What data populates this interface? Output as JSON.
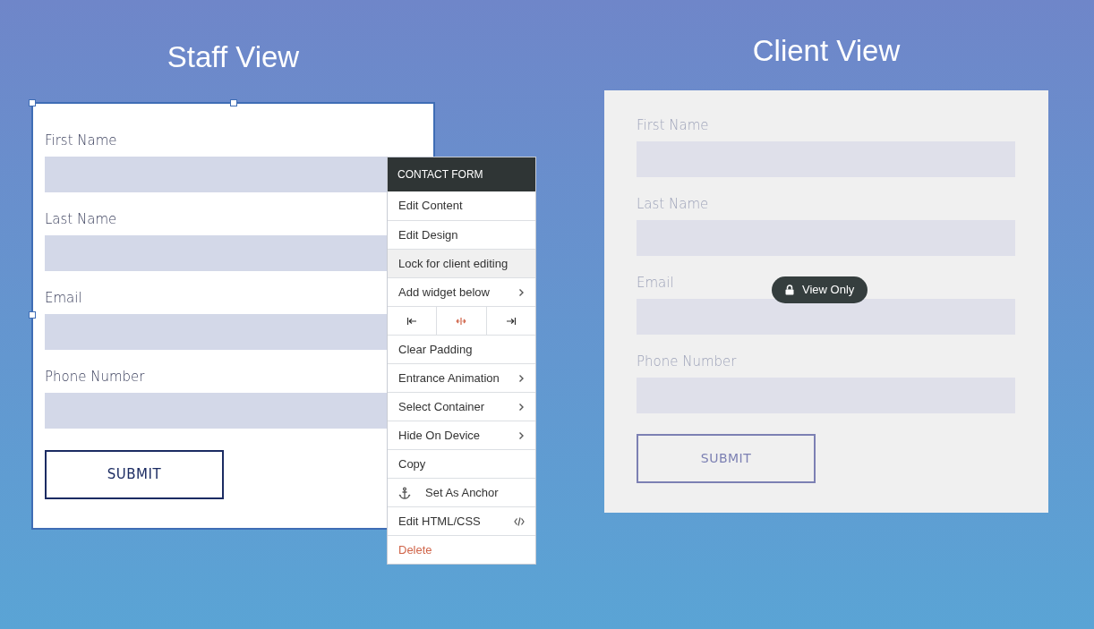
{
  "staff_view": {
    "title": "Staff View",
    "fields": [
      {
        "label": "First Name"
      },
      {
        "label": "Last Name"
      },
      {
        "label": "Email"
      },
      {
        "label": "Phone Number"
      }
    ],
    "submit": "SUBMIT"
  },
  "context_menu": {
    "header": "CONTACT FORM",
    "items": [
      {
        "kind": "item",
        "label": "Edit Content",
        "highlighted": false
      },
      {
        "kind": "item",
        "label": "Edit Design",
        "highlighted": false
      },
      {
        "kind": "item",
        "label": "Lock for client editing",
        "highlighted": true
      },
      {
        "kind": "submenu",
        "label": "Add widget below",
        "highlighted": false
      },
      {
        "kind": "align",
        "buttons": [
          {
            "active": false
          },
          {
            "active": true
          },
          {
            "active": false
          }
        ]
      },
      {
        "kind": "item",
        "label": "Clear Padding",
        "highlighted": false
      },
      {
        "kind": "submenu",
        "label": "Entrance Animation",
        "highlighted": false
      },
      {
        "kind": "submenu",
        "label": "Select Container",
        "highlighted": false
      },
      {
        "kind": "submenu",
        "label": "Hide On Device",
        "highlighted": false
      },
      {
        "kind": "item",
        "label": "Copy",
        "highlighted": false
      },
      {
        "kind": "anchor",
        "label": "Set As Anchor",
        "highlighted": false
      },
      {
        "kind": "code",
        "label": "Edit HTML/CSS",
        "highlighted": false
      },
      {
        "kind": "danger",
        "label": "Delete",
        "highlighted": false
      }
    ]
  },
  "client_view": {
    "title": "Client View",
    "fields": [
      {
        "label": "First Name"
      },
      {
        "label": "Last Name"
      },
      {
        "label": "Email"
      },
      {
        "label": "Phone Number"
      }
    ],
    "submit": "SUBMIT",
    "badge": "View Only"
  }
}
